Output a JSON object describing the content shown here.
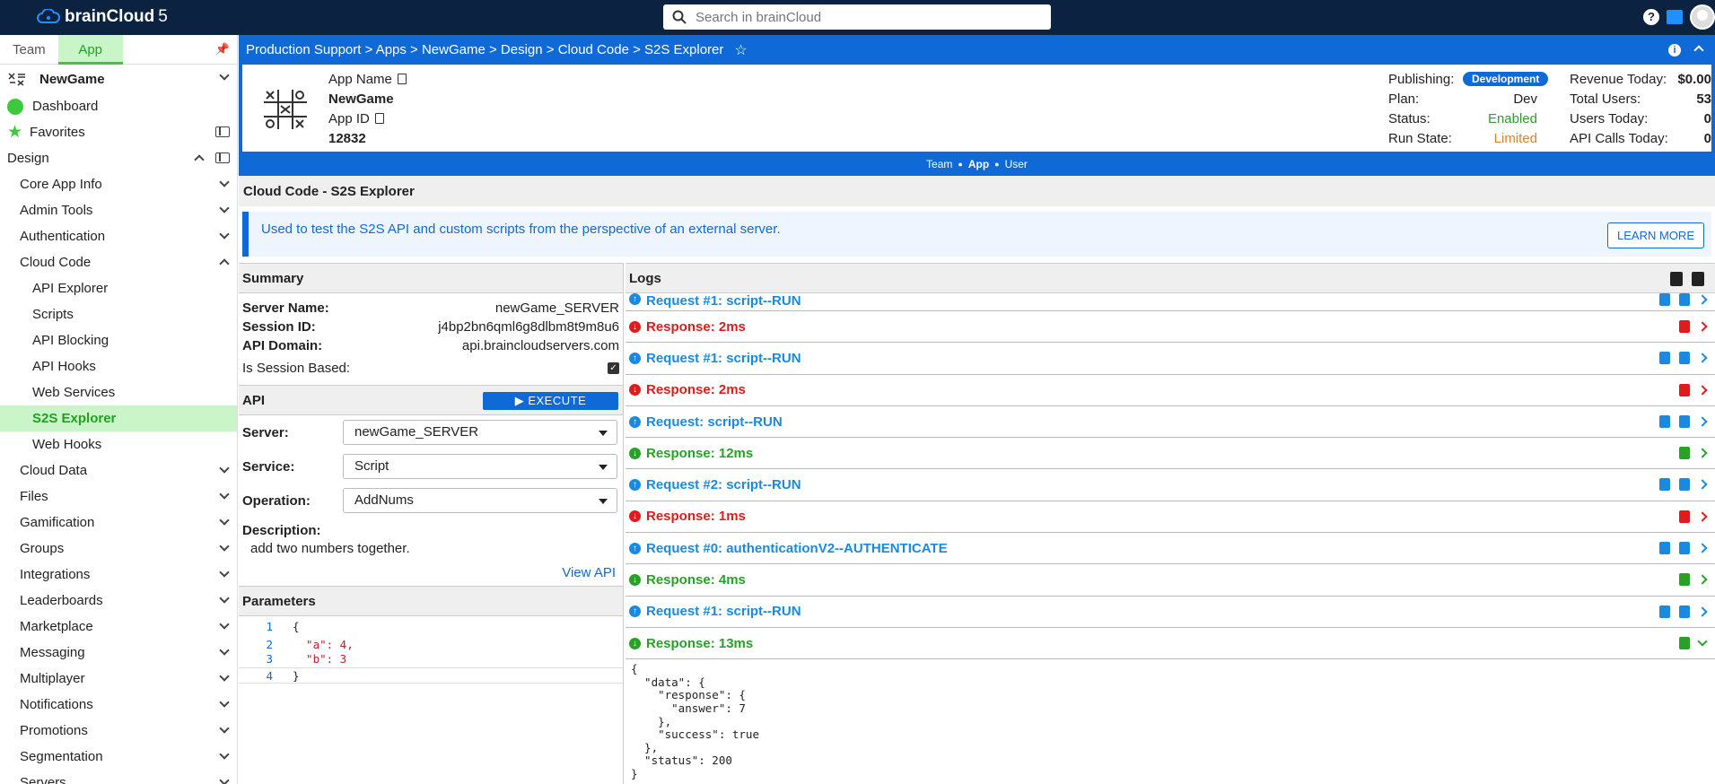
{
  "topbar": {
    "brand": "brainCloud",
    "brand_version": "5",
    "search_placeholder": "Search in brainCloud",
    "help_label": "?"
  },
  "sidebar": {
    "tabs": [
      "Team",
      "App"
    ],
    "active_tab": "App",
    "app_name": "NewGame",
    "dashboard": "Dashboard",
    "favorites": "Favorites",
    "design": "Design",
    "sections": [
      {
        "label": "Core App Info",
        "expanded": false
      },
      {
        "label": "Admin Tools",
        "expanded": false
      },
      {
        "label": "Authentication",
        "expanded": false
      },
      {
        "label": "Cloud Code",
        "expanded": true
      }
    ],
    "cloud_code_items": [
      "API Explorer",
      "Scripts",
      "API Blocking",
      "API Hooks",
      "Web Services",
      "S2S Explorer",
      "Web Hooks"
    ],
    "active_item": "S2S Explorer",
    "more_sections": [
      "Cloud Data",
      "Files",
      "Gamification",
      "Groups",
      "Integrations",
      "Leaderboards",
      "Marketplace",
      "Messaging",
      "Multiplayer",
      "Notifications",
      "Promotions",
      "Segmentation",
      "Servers"
    ]
  },
  "breadcrumb": {
    "items": [
      "Production Support",
      "Apps",
      "NewGame",
      "Design",
      "Cloud Code",
      "S2S Explorer"
    ],
    "separator": ">",
    "text": "Production Support > Apps > NewGame > Design > Cloud Code > S2S Explorer"
  },
  "app_info": {
    "app_name_label": "App Name",
    "app_name": "NewGame",
    "app_id_label": "App ID",
    "app_id": "12832",
    "publishing_label": "Publishing:",
    "publishing": "Development",
    "plan_label": "Plan:",
    "plan": "Dev",
    "status_label": "Status:",
    "status": "Enabled",
    "run_state_label": "Run State:",
    "run_state": "Limited",
    "revenue_label": "Revenue Today:",
    "revenue": "$0.00",
    "total_users_label": "Total Users:",
    "total_users": "53",
    "users_today_label": "Users Today:",
    "users_today": "0",
    "api_calls_label": "API Calls Today:",
    "api_calls": "0"
  },
  "scope": {
    "team": "Team",
    "app": "App",
    "user": "User"
  },
  "page": {
    "title": "Cloud Code - S2S Explorer",
    "info": "Used to test the S2S API and custom scripts from the perspective of an external server.",
    "learn_more": "LEARN MORE"
  },
  "summary": {
    "title": "Summary",
    "server_name_label": "Server Name:",
    "server_name": "newGame_SERVER",
    "session_id_label": "Session ID:",
    "session_id": "j4bp2bn6qml6g8dlbm8t9m8u6",
    "api_domain_label": "API Domain:",
    "api_domain": "api.braincloudservers.com",
    "session_based_label": "Is Session Based:",
    "session_based": true
  },
  "api": {
    "title": "API",
    "execute": "EXECUTE",
    "server_label": "Server:",
    "server": "newGame_SERVER",
    "service_label": "Service:",
    "service": "Script",
    "operation_label": "Operation:",
    "operation": "AddNums",
    "description_label": "Description:",
    "description": "add two numbers together.",
    "view_api": "View API"
  },
  "parameters": {
    "title": "Parameters",
    "lines": [
      "{",
      "  \"a\": 4,",
      "  \"b\": 3",
      "}"
    ]
  },
  "logs": {
    "title": "Logs",
    "entries": [
      {
        "type": "req",
        "label": "Request #1: script--RUN",
        "partial": true
      },
      {
        "type": "resp-err",
        "label": "Response: 2ms"
      },
      {
        "type": "req",
        "label": "Request #1: script--RUN"
      },
      {
        "type": "resp-err",
        "label": "Response: 2ms"
      },
      {
        "type": "req",
        "label": "Request: script--RUN"
      },
      {
        "type": "resp-ok",
        "label": "Response: 12ms"
      },
      {
        "type": "req",
        "label": "Request #2: script--RUN"
      },
      {
        "type": "resp-err",
        "label": "Response: 1ms"
      },
      {
        "type": "req",
        "label": "Request #0: authenticationV2--AUTHENTICATE"
      },
      {
        "type": "resp-ok",
        "label": "Response: 4ms"
      },
      {
        "type": "req",
        "label": "Request #1: script--RUN"
      },
      {
        "type": "resp-ok",
        "label": "Response: 13ms",
        "expanded": true
      }
    ],
    "expanded_body": "{\n  \"data\": {\n    \"response\": {\n      \"answer\": 7\n    },\n    \"success\": true\n  },\n  \"status\": 200\n}"
  },
  "colors": {
    "navy": "#0b2340",
    "primary": "#0f6ad8",
    "green": "#27a227",
    "red": "#e01b1b",
    "orange": "#d9822b",
    "active_bg": "#c9f5c9"
  }
}
